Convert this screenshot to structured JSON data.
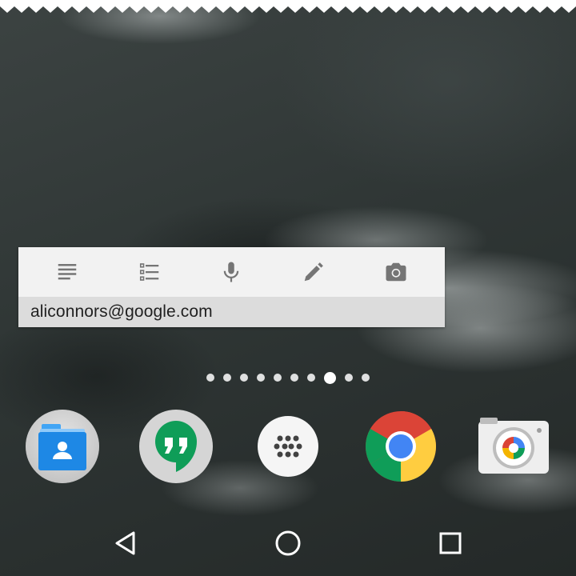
{
  "keep_widget": {
    "account": "aliconnors@google.com",
    "actions": [
      {
        "icon": "text-note-icon"
      },
      {
        "icon": "checklist-icon"
      },
      {
        "icon": "microphone-icon"
      },
      {
        "icon": "pen-icon"
      },
      {
        "icon": "camera-icon"
      }
    ]
  },
  "page_indicator": {
    "page_count": 10,
    "current_page": 8
  },
  "dock": {
    "apps": [
      {
        "icon": "contacts-folder-icon"
      },
      {
        "icon": "hangouts-icon"
      },
      {
        "icon": "app-drawer-icon"
      },
      {
        "icon": "chrome-icon"
      },
      {
        "icon": "camera-app-icon"
      }
    ]
  },
  "nav_bar": {
    "buttons": [
      "back-icon",
      "home-icon",
      "recents-icon"
    ]
  },
  "colors": {
    "widget_background": "#f2f2f2",
    "account_bar": "#dcdcdc",
    "hangouts_green": "#0f9d58",
    "contacts_blue": "#1e88e5"
  }
}
